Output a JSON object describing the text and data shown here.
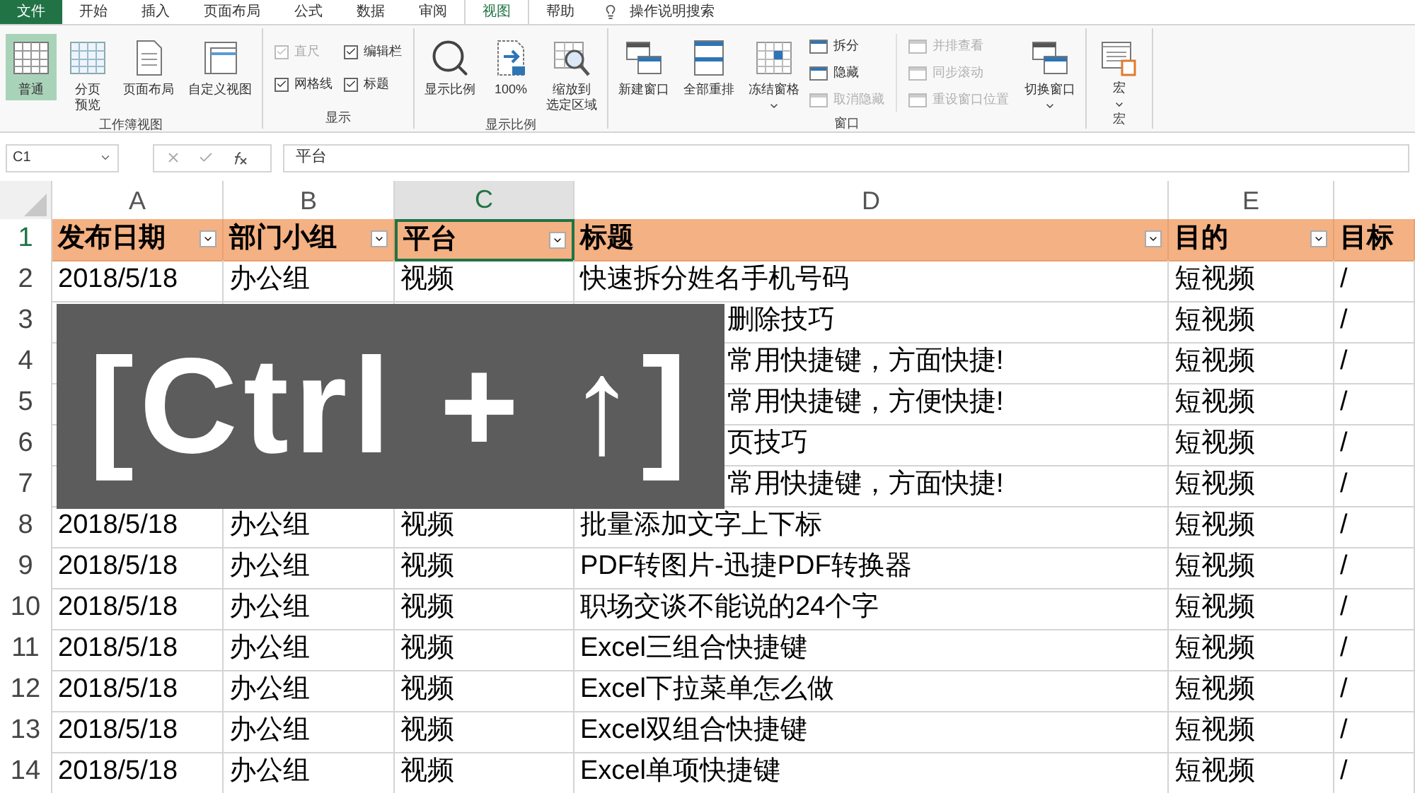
{
  "tabs": [
    {
      "label": "文件",
      "kind": "file",
      "selected": false
    },
    {
      "label": "开始",
      "selected": false
    },
    {
      "label": "插入",
      "selected": false
    },
    {
      "label": "页面布局",
      "selected": false
    },
    {
      "label": "公式",
      "selected": false
    },
    {
      "label": "数据",
      "selected": false
    },
    {
      "label": "审阅",
      "selected": false
    },
    {
      "label": "视图",
      "selected": true
    },
    {
      "label": "帮助",
      "selected": false
    }
  ],
  "tell_me": "操作说明搜索",
  "ribbon": {
    "workbook_views": {
      "label": "工作簿视图",
      "items": [
        {
          "lines": [
            "普通"
          ],
          "selected": true
        },
        {
          "lines": [
            "分页",
            "预览"
          ],
          "selected": false
        },
        {
          "lines": [
            "页面布局"
          ],
          "selected": false
        },
        {
          "lines": [
            "自定义视图"
          ],
          "selected": false
        }
      ]
    },
    "show": {
      "label": "显示",
      "items": [
        {
          "label": "直尺",
          "checked": true,
          "disabled": true
        },
        {
          "label": "编辑栏",
          "checked": true,
          "disabled": false
        },
        {
          "label": "网格线",
          "checked": true,
          "disabled": false
        },
        {
          "label": "标题",
          "checked": true,
          "disabled": false
        }
      ]
    },
    "zoom": {
      "label": "显示比例",
      "items": [
        {
          "lines": [
            "显示比例"
          ]
        },
        {
          "lines": [
            "100%"
          ]
        },
        {
          "lines": [
            "缩放到",
            "选定区域"
          ]
        }
      ]
    },
    "window": {
      "label": "窗口",
      "large": [
        {
          "lines": [
            "新建窗口"
          ],
          "dropdown": false
        },
        {
          "lines": [
            "全部重排"
          ],
          "dropdown": false
        },
        {
          "lines": [
            "冻结窗格"
          ],
          "dropdown": true
        }
      ],
      "small": [
        {
          "label": "拆分",
          "disabled": false
        },
        {
          "label": "隐藏",
          "disabled": false
        },
        {
          "label": "取消隐藏",
          "disabled": true
        }
      ],
      "side": [
        {
          "label": "并排查看",
          "disabled": true
        },
        {
          "label": "同步滚动",
          "disabled": true
        },
        {
          "label": "重设窗口位置",
          "disabled": true
        }
      ],
      "switch": {
        "lines": [
          "切换窗口"
        ],
        "dropdown": true
      }
    },
    "macros": {
      "label": "宏",
      "button": "宏"
    }
  },
  "formula_bar": {
    "name_box": "C1",
    "formula": "平台"
  },
  "columns": [
    {
      "letter": "A",
      "selected": false
    },
    {
      "letter": "B",
      "selected": false
    },
    {
      "letter": "C",
      "selected": true
    },
    {
      "letter": "D",
      "selected": false
    },
    {
      "letter": "E",
      "selected": false
    }
  ],
  "header_row": {
    "number": "1",
    "cells": [
      "发布日期",
      "部门小组",
      "平台",
      "标题",
      "目的",
      "目标"
    ]
  },
  "rows": [
    {
      "number": "2",
      "cells": [
        "2018/5/18",
        "办公组",
        "视频",
        "快速拆分姓名手机号码",
        "短视频",
        "/"
      ]
    },
    {
      "number": "3",
      "kind": "covered",
      "cells": [
        "删除技巧",
        "短视频",
        "/"
      ]
    },
    {
      "number": "4",
      "kind": "covered",
      "cells": [
        "常用快捷键，方面快捷!",
        "短视频",
        "/"
      ]
    },
    {
      "number": "5",
      "kind": "covered",
      "cells": [
        "常用快捷键，方便快捷!",
        "短视频",
        "/"
      ]
    },
    {
      "number": "6",
      "kind": "covered",
      "cells": [
        "页技巧",
        "短视频",
        "/"
      ]
    },
    {
      "number": "7",
      "kind": "covered",
      "cells": [
        "常用快捷键，方面快捷!",
        "短视频",
        "/"
      ]
    },
    {
      "number": "8",
      "cells": [
        "2018/5/18",
        "办公组",
        "视频",
        "批量添加文字上下标",
        "短视频",
        "/"
      ]
    },
    {
      "number": "9",
      "cells": [
        "2018/5/18",
        "办公组",
        "视频",
        "PDF转图片-迅捷PDF转换器",
        "短视频",
        "/"
      ]
    },
    {
      "number": "10",
      "cells": [
        "2018/5/18",
        "办公组",
        "视频",
        "职场交谈不能说的24个字",
        "短视频",
        "/"
      ]
    },
    {
      "number": "11",
      "cells": [
        "2018/5/18",
        "办公组",
        "视频",
        "Excel三组合快捷键",
        "短视频",
        "/"
      ]
    },
    {
      "number": "12",
      "cells": [
        "2018/5/18",
        "办公组",
        "视频",
        "Excel下拉菜单怎么做",
        "短视频",
        "/"
      ]
    },
    {
      "number": "13",
      "cells": [
        "2018/5/18",
        "办公组",
        "视频",
        "Excel双组合快捷键",
        "短视频",
        "/"
      ]
    },
    {
      "number": "14",
      "cells": [
        "2018/5/18",
        "办公组",
        "视频",
        "Excel单项快捷键",
        "短视频",
        "/"
      ]
    }
  ],
  "key_overlay": {
    "text": "[Ctrl + ↑]"
  }
}
